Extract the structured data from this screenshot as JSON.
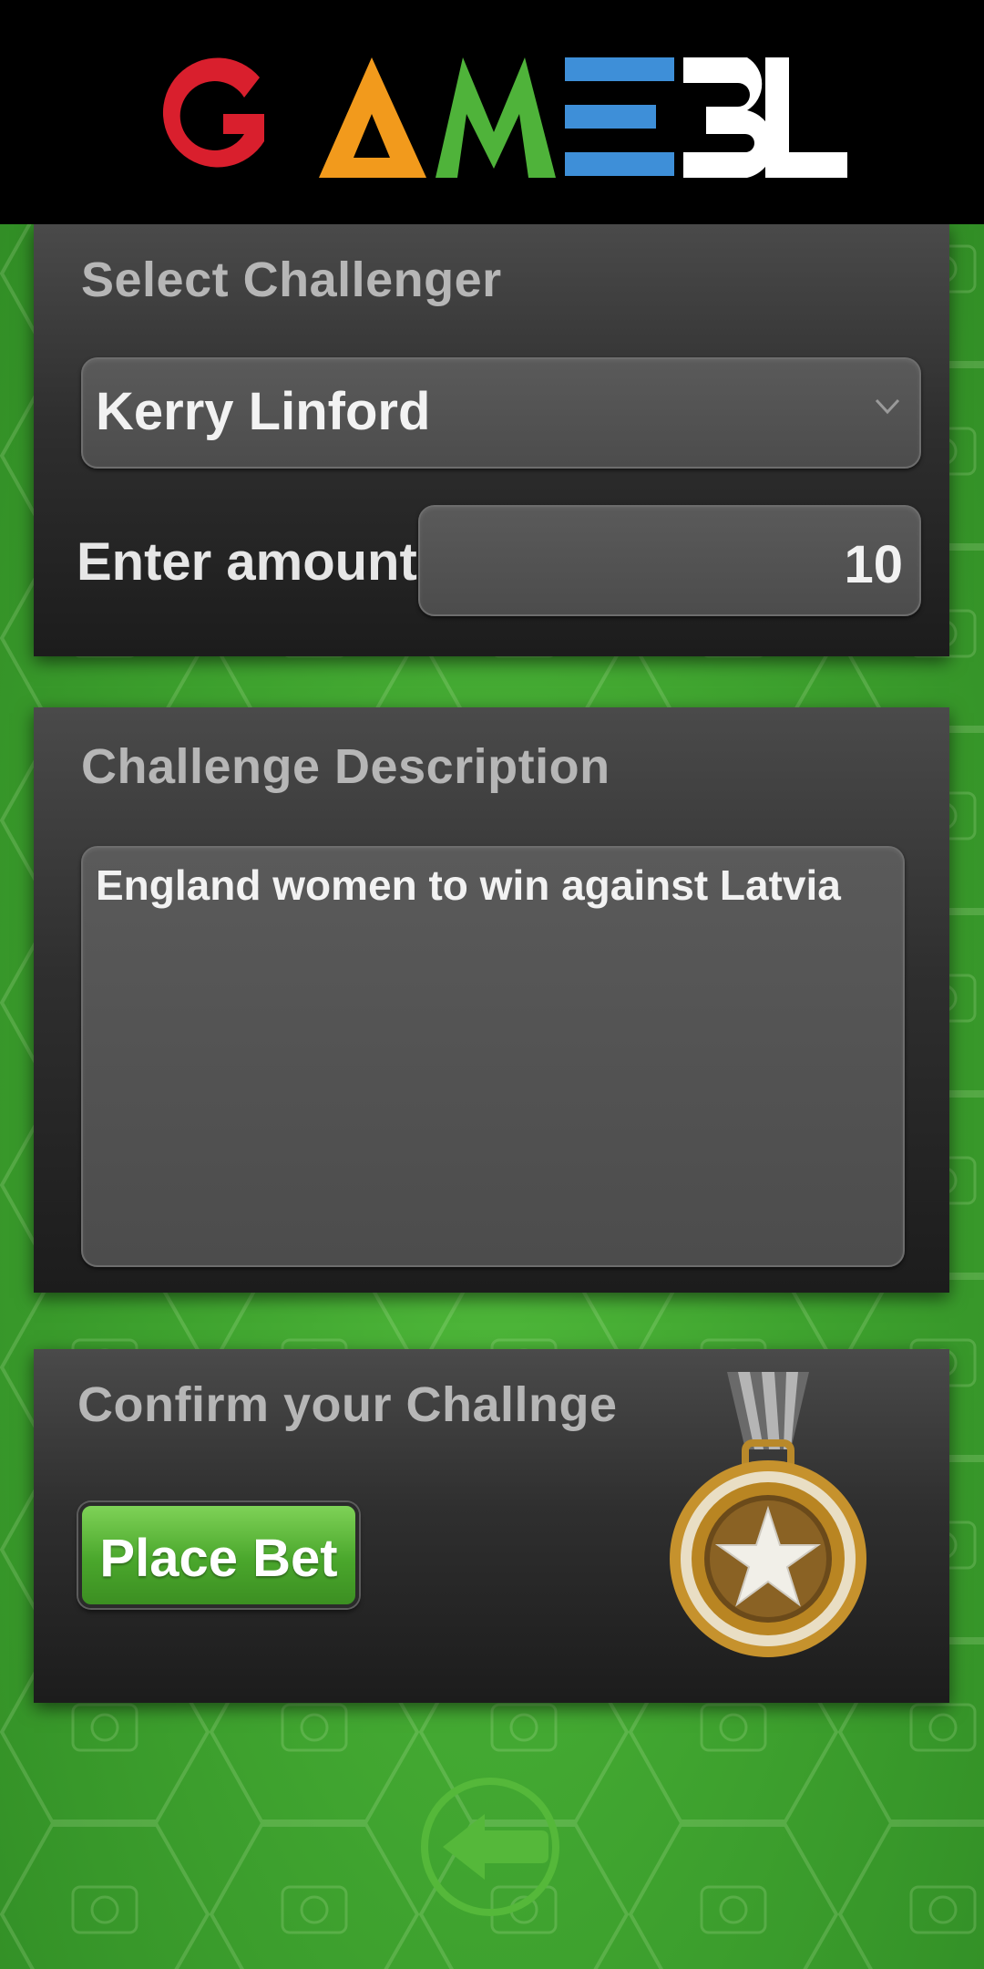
{
  "header": {
    "logo_text": "GAMEBL",
    "logo_colors": [
      "#d91f2d",
      "#f29a1c",
      "#4fb33a",
      "#3e8fd8",
      "#ffffff",
      "#ffffff"
    ]
  },
  "challenger_panel": {
    "title": "Select Challenger",
    "selected_challenger": "Kerry Linford",
    "amount_label": "Enter amount",
    "amount_value": "10"
  },
  "description_panel": {
    "title": "Challenge Description",
    "description": "England women to win against Latvia"
  },
  "confirm_panel": {
    "title": "Confirm your Challnge",
    "place_bet_label": "Place Bet",
    "medal_icon": "medal-star-icon"
  },
  "footer": {
    "back_icon": "back-arrow-icon"
  },
  "colors": {
    "background_green": "#3fa32f",
    "button_green": "#4aa72c",
    "panel_dark": "#2f2f2f"
  }
}
